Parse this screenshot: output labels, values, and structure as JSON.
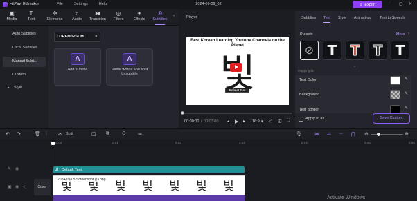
{
  "app": {
    "name": "HitPaw Edimakor",
    "doc_title": "2024-09-09_02",
    "export_label": "Export"
  },
  "menu": [
    "File",
    "Settings",
    "Help"
  ],
  "toolbar": {
    "tools": [
      {
        "label": "Media",
        "icon": "▣"
      },
      {
        "label": "Text",
        "icon": "T"
      },
      {
        "label": "Elements",
        "icon": "✣"
      },
      {
        "label": "Audio",
        "icon": "♫"
      },
      {
        "label": "Transition",
        "icon": "⧓"
      },
      {
        "label": "Filters",
        "icon": "◎"
      },
      {
        "label": "Effects",
        "icon": "✦"
      },
      {
        "label": "Subtitles",
        "icon": "Ꭿ"
      }
    ]
  },
  "leftnav": {
    "items": [
      "Auto Subtitles",
      "Local Subtitles",
      "Manual Subt...",
      "Custom",
      "Style"
    ]
  },
  "content": {
    "font_dropdown": "LOREM IPSUM",
    "cards": [
      {
        "label": "Add subtitle",
        "icon": "A"
      },
      {
        "label": "Paste words and split to subtitle",
        "icon": "A"
      }
    ]
  },
  "player": {
    "title": "Player",
    "headline": "Best Korean Learning Youtube Channels on the Planet",
    "big_char": "빛",
    "sub_tag": "Default Text",
    "time_current": "00:00:00",
    "time_total": "00:03:00",
    "aspect": "16:9"
  },
  "props": {
    "tabs": [
      "Subtitles",
      "Text",
      "Style",
      "Animation",
      "Text to Speech"
    ],
    "presets_label": "Presets",
    "more_label": "More",
    "mapping_label": "Mapping list",
    "text_color_label": "Text Color",
    "background_label": "Background",
    "text_border_label": "Text Border",
    "apply_all_label": "Apply to all",
    "save_custom_label": "Save Custom",
    "text_color": "#ffffff",
    "border_color": "#000000"
  },
  "timeline": {
    "split_label": "Split",
    "ruler": [
      "00:00",
      "0:01",
      "0:02",
      "0:03",
      "0:04",
      "0:05",
      "0:06"
    ],
    "text_clip": "Default Text",
    "video_clip": "2024-09-05 Screenshot (1).png",
    "cover_label": "Cover",
    "watermark": "Activate Windows"
  }
}
